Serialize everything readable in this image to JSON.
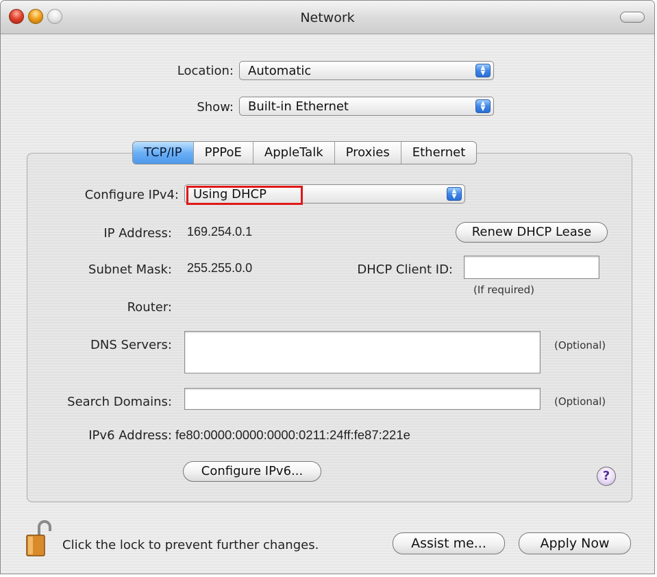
{
  "window": {
    "title": "Network"
  },
  "location": {
    "label": "Location:",
    "value": "Automatic"
  },
  "show": {
    "label": "Show:",
    "value": "Built-in Ethernet"
  },
  "tabs": [
    {
      "label": "TCP/IP",
      "selected": true
    },
    {
      "label": "PPPoE",
      "selected": false
    },
    {
      "label": "AppleTalk",
      "selected": false
    },
    {
      "label": "Proxies",
      "selected": false
    },
    {
      "label": "Ethernet",
      "selected": false
    }
  ],
  "tcpip": {
    "configure_ipv4_label": "Configure IPv4:",
    "configure_ipv4_value": "Using DHCP",
    "ip_address_label": "IP Address:",
    "ip_address": "169.254.0.1",
    "renew_button": "Renew DHCP Lease",
    "subnet_mask_label": "Subnet Mask:",
    "subnet_mask": "255.255.0.0",
    "dhcp_client_id_label": "DHCP Client ID:",
    "dhcp_client_id_value": "",
    "dhcp_client_id_hint": "(If required)",
    "router_label": "Router:",
    "router": "",
    "dns_servers_label": "DNS Servers:",
    "dns_servers_value": "",
    "dns_hint": "(Optional)",
    "search_domains_label": "Search Domains:",
    "search_domains_value": "",
    "search_hint": "(Optional)",
    "ipv6_address_label": "IPv6 Address:",
    "ipv6_address": "fe80:0000:0000:0000:0211:24ff:fe87:221e",
    "configure_ipv6_button": "Configure IPv6...",
    "help_button": "?"
  },
  "footer": {
    "lock_text": "Click the lock to prevent further changes.",
    "assist_button": "Assist me...",
    "apply_button": "Apply Now"
  },
  "icons": {
    "close": "close-icon",
    "minimize": "minimize-icon",
    "zoom": "zoom-icon",
    "toolbar_toggle": "toolbar-toggle-icon",
    "popup_arrows": "popup-arrows-icon",
    "help": "help-icon",
    "lock": "lock-icon",
    "cursor": "mouse-cursor-icon"
  },
  "colors": {
    "highlight_box": "#e01818",
    "selected_tab": "#4d98eb",
    "popup_arrows": "#3d86e8"
  }
}
